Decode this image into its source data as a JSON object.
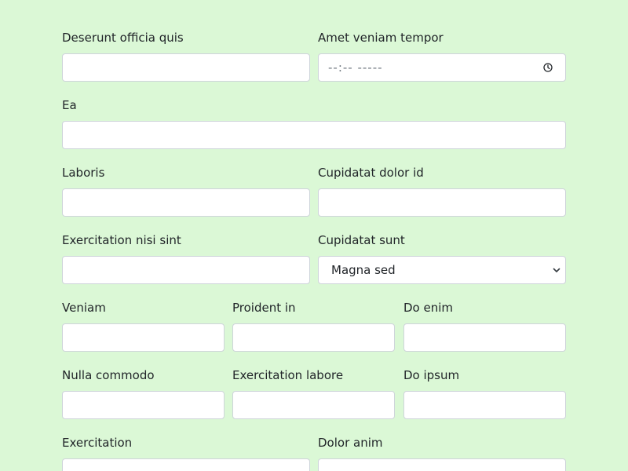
{
  "form": {
    "rows": [
      {
        "fields": [
          {
            "label": "Deserunt officia quis",
            "value": ""
          },
          {
            "label": "Amet veniam tempor",
            "type": "time",
            "display": "--:-- -----"
          }
        ]
      },
      {
        "fields": [
          {
            "label": "Ea",
            "value": ""
          }
        ]
      },
      {
        "fields": [
          {
            "label": "Laboris",
            "value": ""
          },
          {
            "label": "Cupidatat dolor id",
            "value": ""
          }
        ]
      },
      {
        "fields": [
          {
            "label": "Exercitation nisi sint",
            "value": ""
          },
          {
            "label": "Cupidatat sunt",
            "type": "select",
            "selected": "Magna sed"
          }
        ]
      },
      {
        "fields": [
          {
            "label": "Veniam",
            "value": ""
          },
          {
            "label": "Proident in",
            "value": ""
          },
          {
            "label": "Do enim",
            "value": ""
          }
        ]
      },
      {
        "fields": [
          {
            "label": "Nulla commodo",
            "value": ""
          },
          {
            "label": "Exercitation labore",
            "value": ""
          },
          {
            "label": "Do ipsum",
            "value": ""
          }
        ]
      },
      {
        "fields": [
          {
            "label": "Exercitation",
            "value": ""
          },
          {
            "label": "Dolor anim",
            "value": ""
          }
        ]
      }
    ]
  },
  "icons": {
    "time": "clock-icon",
    "select": "chevron-down-icon"
  }
}
